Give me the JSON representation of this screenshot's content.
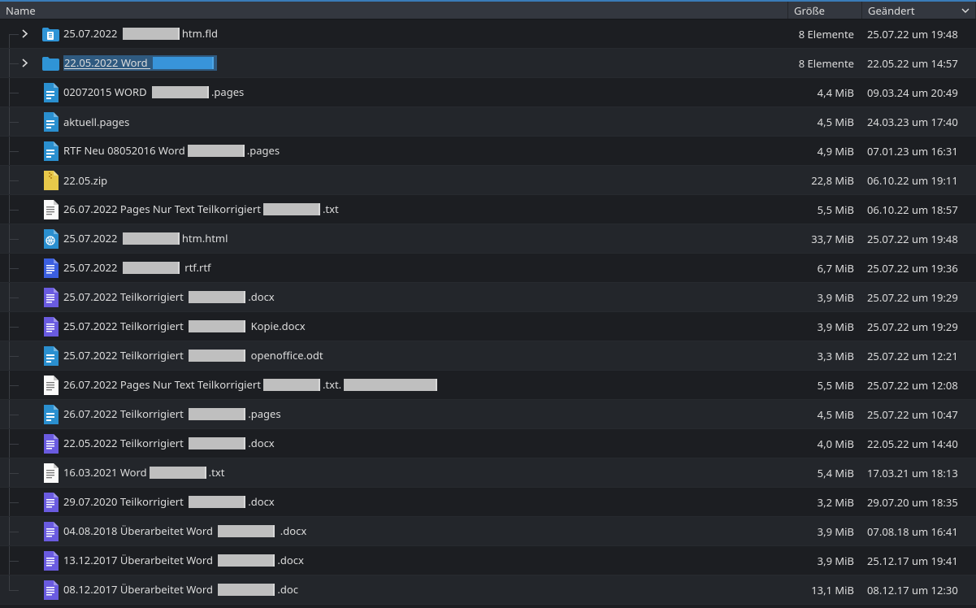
{
  "columns": {
    "name": "Name",
    "size": "Größe",
    "modified": "Geändert"
  },
  "rows": [
    {
      "icon": "folder-doc",
      "expandable": true,
      "parts": [
        [
          "t",
          "25.07.2022 "
        ],
        [
          "r",
          70
        ],
        [
          "t",
          "htm.fld"
        ]
      ],
      "size": "8 Elemente",
      "date": "25.07.22 um 19:48"
    },
    {
      "icon": "folder",
      "expandable": true,
      "selected": true,
      "parts": [
        [
          "t",
          "22.05.2022 Word "
        ],
        [
          "rs",
          75
        ]
      ],
      "size": "8 Elemente",
      "date": "22.05.22 um 14:57"
    },
    {
      "icon": "pages",
      "parts": [
        [
          "t",
          "02072015 WORD "
        ],
        [
          "r",
          70
        ],
        [
          "t",
          ".pages"
        ]
      ],
      "size": "4,4 MiB",
      "date": "09.03.24 um 20:49"
    },
    {
      "icon": "pages",
      "parts": [
        [
          "t",
          "aktuell.pages"
        ]
      ],
      "size": "4,5 MiB",
      "date": "24.03.23 um 17:40"
    },
    {
      "icon": "pages",
      "parts": [
        [
          "t",
          "RTF Neu 08052016 Word"
        ],
        [
          "r",
          70
        ],
        [
          "t",
          ".pages"
        ]
      ],
      "size": "4,9 MiB",
      "date": "07.01.23 um 16:31"
    },
    {
      "icon": "zip",
      "parts": [
        [
          "t",
          "22.05.zip"
        ]
      ],
      "size": "22,8 MiB",
      "date": "06.10.22 um 19:11"
    },
    {
      "icon": "txt",
      "parts": [
        [
          "t",
          "26.07.2022 Pages Nur Text Teilkorrigiert"
        ],
        [
          "r",
          70
        ],
        [
          "t",
          ".txt"
        ]
      ],
      "size": "5,5 MiB",
      "date": "06.10.22 um 18:57"
    },
    {
      "icon": "html",
      "parts": [
        [
          "t",
          "25.07.2022 "
        ],
        [
          "r",
          70
        ],
        [
          "t",
          "htm.html"
        ]
      ],
      "size": "33,7 MiB",
      "date": "25.07.22 um 19:48"
    },
    {
      "icon": "rtf",
      "parts": [
        [
          "t",
          "25.07.2022 "
        ],
        [
          "r",
          70
        ],
        [
          "t",
          " rtf.rtf"
        ]
      ],
      "size": "6,7 MiB",
      "date": "25.07.22 um 19:36"
    },
    {
      "icon": "docx",
      "parts": [
        [
          "t",
          "25.07.2022 Teilkorrigiert "
        ],
        [
          "r",
          70
        ],
        [
          "t",
          ".docx"
        ]
      ],
      "size": "3,9 MiB",
      "date": "25.07.22 um 19:29"
    },
    {
      "icon": "docx",
      "parts": [
        [
          "t",
          "25.07.2022 Teilkorrigiert "
        ],
        [
          "r",
          70
        ],
        [
          "t",
          " Kopie.docx"
        ]
      ],
      "size": "3,9 MiB",
      "date": "25.07.22 um 19:29"
    },
    {
      "icon": "odt",
      "parts": [
        [
          "t",
          "25.07.2022 Teilkorrigiert "
        ],
        [
          "r",
          70
        ],
        [
          "t",
          " openoffice.odt"
        ]
      ],
      "size": "3,3 MiB",
      "date": "25.07.22 um 12:21"
    },
    {
      "icon": "txt",
      "parts": [
        [
          "t",
          "26.07.2022 Pages Nur Text Teilkorrigiert"
        ],
        [
          "r",
          70
        ],
        [
          "t",
          ".txt."
        ],
        [
          "r",
          115
        ]
      ],
      "size": "5,5 MiB",
      "date": "25.07.22 um 12:08"
    },
    {
      "icon": "pages",
      "parts": [
        [
          "t",
          "26.07.2022 Teilkorrigiert "
        ],
        [
          "r",
          70
        ],
        [
          "t",
          ".pages"
        ]
      ],
      "size": "4,5 MiB",
      "date": "25.07.22 um 10:47"
    },
    {
      "icon": "docx",
      "parts": [
        [
          "t",
          "22.05.2022 Teilkorrigiert "
        ],
        [
          "r",
          70
        ],
        [
          "t",
          ".docx"
        ]
      ],
      "size": "4,0 MiB",
      "date": "22.05.22 um 14:40"
    },
    {
      "icon": "txt",
      "parts": [
        [
          "t",
          "16.03.2021  Word"
        ],
        [
          "r",
          70
        ],
        [
          "t",
          ".txt"
        ]
      ],
      "size": "5,4 MiB",
      "date": "17.03.21 um 18:13"
    },
    {
      "icon": "docx",
      "parts": [
        [
          "t",
          "29.07.2020 Teilkorrigiert "
        ],
        [
          "r",
          70
        ],
        [
          "t",
          ".docx"
        ]
      ],
      "size": "3,2 MiB",
      "date": "29.07.20 um 18:35"
    },
    {
      "icon": "docx",
      "parts": [
        [
          "t",
          "04.08.2018 Überarbeitet  Word "
        ],
        [
          "r",
          70
        ],
        [
          "t",
          " .docx"
        ]
      ],
      "size": "3,9 MiB",
      "date": "07.08.18 um 16:41"
    },
    {
      "icon": "docx",
      "parts": [
        [
          "t",
          "13.12.2017 Überarbeitet  Word "
        ],
        [
          "r",
          70
        ],
        [
          "t",
          ".docx"
        ]
      ],
      "size": "3,9 MiB",
      "date": "25.12.17 um 19:41"
    },
    {
      "icon": "docx",
      "parts": [
        [
          "t",
          "08.12.2017 Überarbeitet  Word "
        ],
        [
          "r",
          70
        ],
        [
          "t",
          ".doc"
        ]
      ],
      "size": "13,1 MiB",
      "date": "08.12.17 um 12:30"
    }
  ]
}
